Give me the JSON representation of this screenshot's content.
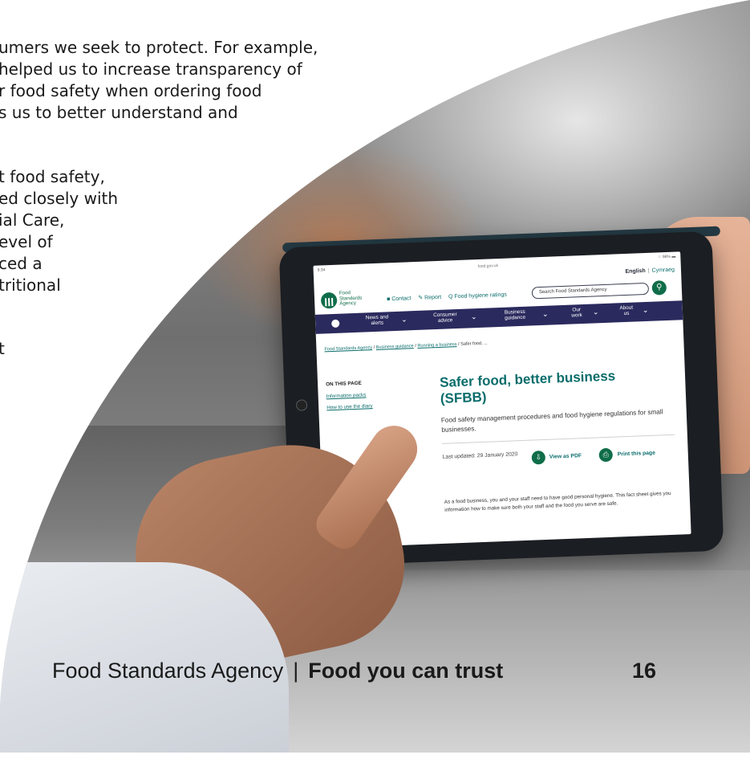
{
  "article": {
    "lines": [
      "umers we seek to protect. For example,",
      "helped us to increase transparency of",
      "r food safety when ordering food",
      "s us to better understand and",
      "t food safety,",
      "ed closely with",
      "ial Care,",
      "evel of",
      "ced a",
      "tritional",
      "t"
    ]
  },
  "tablet": {
    "status": {
      "time": "9:34",
      "url": "food.gov.uk",
      "battery": "⌔ 96% ▬"
    },
    "lang": {
      "current": "English",
      "separator": "|",
      "alternate": "Cymraeg"
    },
    "logo": {
      "line1": "Food",
      "line2": "Standards",
      "line3": "Agency"
    },
    "toplinks": [
      "■ Contact",
      "✎ Report",
      "Q Food hygiene ratings"
    ],
    "search_placeholder": "Search Food Standards Agency",
    "nav": [
      {
        "l1": "News and",
        "l2": "alerts"
      },
      {
        "l1": "Consumer",
        "l2": "advice"
      },
      {
        "l1": "Business",
        "l2": "guidance"
      },
      {
        "l1": "Our",
        "l2": "work"
      },
      {
        "l1": "About",
        "l2": "us"
      }
    ],
    "breadcrumbs": [
      "Food Standards Agency",
      "Business guidance",
      "Running a business",
      "Safer food, ..."
    ],
    "sidebar": {
      "heading": "ON THIS PAGE",
      "links": [
        "Information packs",
        "How to use the diary"
      ]
    },
    "title_line1": "Safer food, better business",
    "title_line2": "(SFBB)",
    "lead": "Food safety management procedures and food hygiene regulations for small businesses.",
    "updated": "Last updated: 29 January 2020",
    "actions": {
      "pdf": "View as PDF",
      "print": "Print this page"
    },
    "body": "As a food business, you and your staff need to have good personal hygiene. This fact sheet gives you information how to make sure both your staff and the food you serve are safe."
  },
  "footer": {
    "org": "Food Standards Agency",
    "separator": "|",
    "tagline": "Food you can trust",
    "page_number": "16"
  },
  "colors": {
    "brand_green": "#0f6d49",
    "nav_purple": "#2b2a5e",
    "link_teal": "#0a6d6b"
  }
}
